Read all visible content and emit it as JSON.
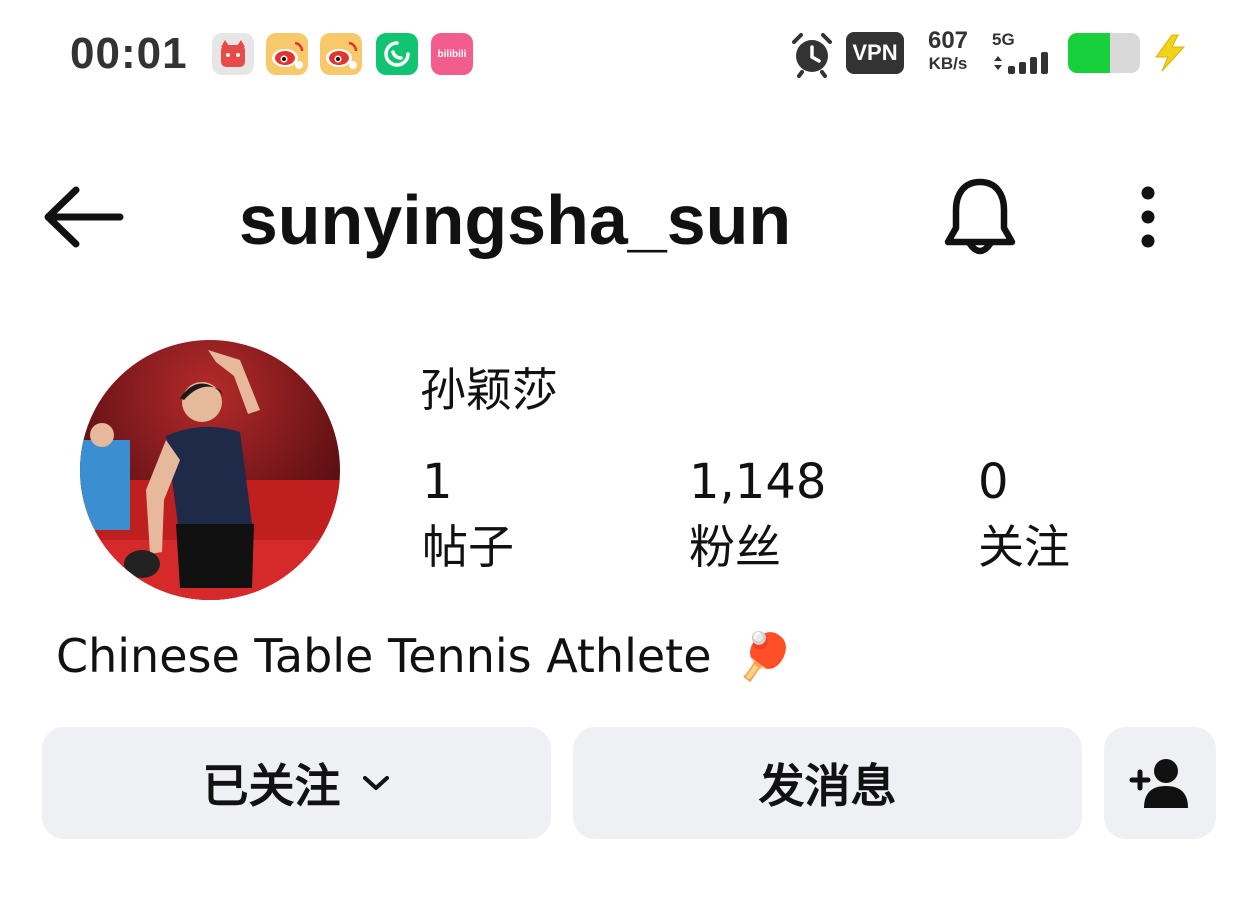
{
  "status_bar": {
    "time": "00:01",
    "app_icons": [
      "pinduoduo-cat-icon",
      "weibo-icon",
      "weibo-icon",
      "phone-chat-icon",
      "bilibili-icon"
    ],
    "bilibili_label": "bilibili",
    "vpn_label": "VPN",
    "net_speed": "607",
    "net_speed_unit": "KB/s",
    "network": "5G",
    "battery_level": 0.58,
    "colors": {
      "battery_fill": "#18d03c",
      "charging_bolt": "#f2d31b",
      "weibo": "#f3a531",
      "chat": "#11c472",
      "bilibili": "#f25d8e",
      "cat": "#e84a4a"
    }
  },
  "header": {
    "username": "sunyingsha_sun",
    "back_icon": "arrow-left-icon",
    "notification_icon": "bell-icon",
    "more_icon": "more-vertical-icon"
  },
  "profile": {
    "display_name": "孙颖莎",
    "stats": [
      {
        "value": "1",
        "label": "帖子"
      },
      {
        "value": "1,148",
        "label": "粉丝"
      },
      {
        "value": "0",
        "label": "关注"
      }
    ],
    "bio": "Chinese Table Tennis Athlete",
    "bio_emoji": "🏓"
  },
  "actions": {
    "following_label": "已关注",
    "message_label": "发消息",
    "add_person_icon": "add-person-icon",
    "button_bg": "#eff0f4"
  }
}
